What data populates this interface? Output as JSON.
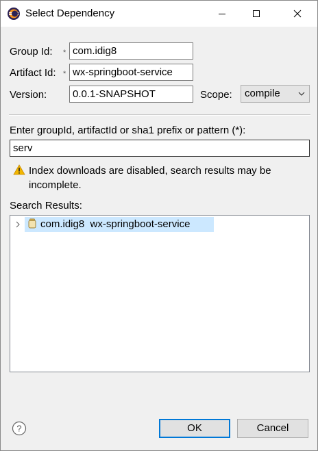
{
  "window": {
    "title": "Select Dependency"
  },
  "form": {
    "group_label": "Group Id:",
    "group_value": "com.idig8",
    "artifact_label": "Artifact Id:",
    "artifact_value": "wx-springboot-service",
    "version_label": "Version:",
    "version_value": "0.0.1-SNAPSHOT",
    "scope_label": "Scope:",
    "scope_value": "compile",
    "required_marker": "*"
  },
  "search": {
    "prompt": "Enter groupId, artifactId or sha1 prefix or pattern (*):",
    "query": "serv",
    "warning_line1": "Index downloads are disabled, search results may be",
    "warning_line2": "incomplete.",
    "results_label": "Search Results:",
    "results": [
      {
        "group": "com.idig8",
        "artifact": "wx-springboot-service"
      }
    ]
  },
  "buttons": {
    "ok": "OK",
    "cancel": "Cancel"
  },
  "icons": {
    "app": "eclipse-icon",
    "warning": "warning-icon",
    "jar": "jar-icon",
    "help": "help-icon"
  },
  "colors": {
    "selection": "#cce8ff",
    "ok_border": "#0078d7",
    "warning": "#f2b600"
  }
}
